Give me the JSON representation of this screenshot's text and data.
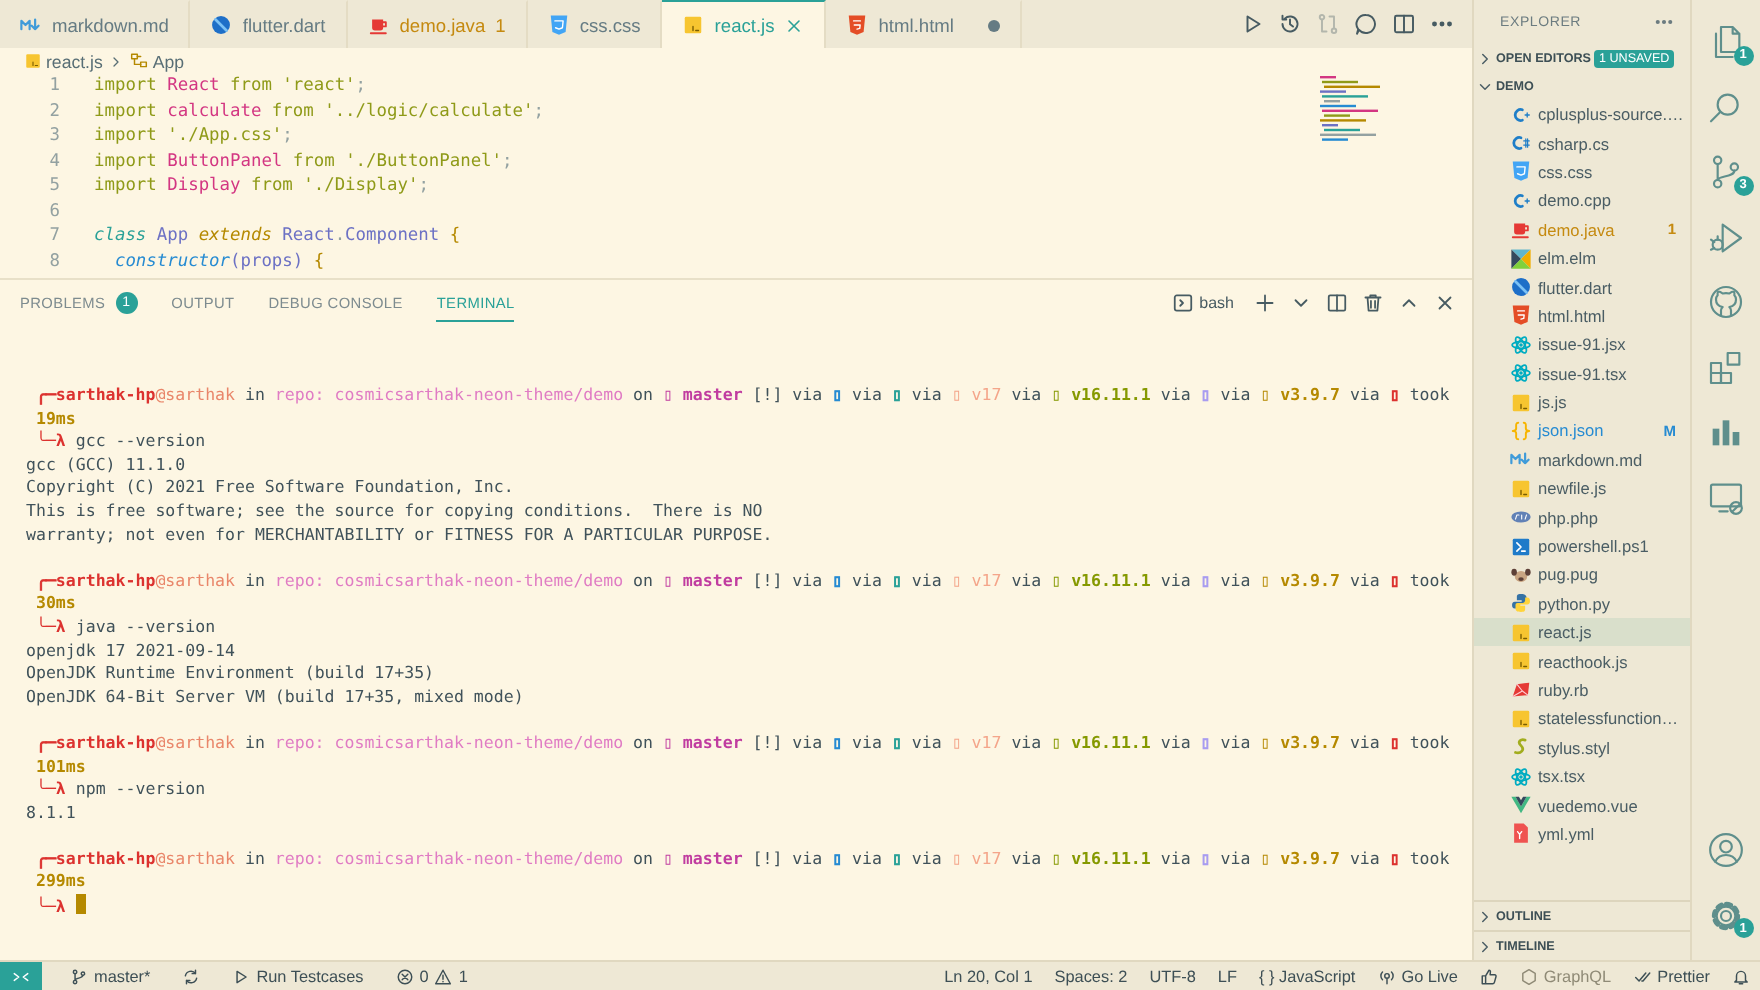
{
  "tabs": [
    {
      "label": "markdown.md",
      "kind": "md",
      "selected": false,
      "dirty": false
    },
    {
      "label": "flutter.dart",
      "kind": "dart",
      "selected": false,
      "dirty": false
    },
    {
      "label": "demo.java",
      "kind": "java",
      "selected": false,
      "dirty": false,
      "problems": "1"
    },
    {
      "label": "css.css",
      "kind": "css",
      "selected": false,
      "dirty": false
    },
    {
      "label": "react.js",
      "kind": "js",
      "selected": true,
      "dirty": false
    },
    {
      "label": "html.html",
      "kind": "html",
      "selected": false,
      "dirty": true
    }
  ],
  "editor_actions": [
    {
      "kind": "run",
      "disabled": false
    },
    {
      "kind": "history",
      "disabled": false
    },
    {
      "kind": "compare",
      "disabled": true
    },
    {
      "kind": "comment",
      "disabled": false
    },
    {
      "kind": "split",
      "disabled": false
    },
    {
      "kind": "more",
      "disabled": false
    }
  ],
  "breadcrumb": [
    {
      "label": "react.js",
      "kind": "js"
    },
    {
      "label": "App",
      "kind": "class"
    }
  ],
  "code": [
    {
      "number": "1",
      "tokens": [
        {
          "text": "import ",
          "kind": "keyword"
        },
        {
          "text": "React",
          "kind": "name"
        },
        {
          "text": " from ",
          "kind": "keyword"
        },
        {
          "text": "'react'",
          "kind": "string"
        },
        {
          "text": ";",
          "kind": "punct"
        }
      ]
    },
    {
      "number": "2",
      "tokens": [
        {
          "text": "import ",
          "kind": "keyword"
        },
        {
          "text": "calculate",
          "kind": "name"
        },
        {
          "text": " from ",
          "kind": "keyword"
        },
        {
          "text": "'../logic/calculate'",
          "kind": "string"
        },
        {
          "text": ";",
          "kind": "punct"
        }
      ]
    },
    {
      "number": "3",
      "tokens": [
        {
          "text": "import ",
          "kind": "keyword"
        },
        {
          "text": "'./App.css'",
          "kind": "string"
        },
        {
          "text": ";",
          "kind": "punct"
        }
      ]
    },
    {
      "number": "4",
      "tokens": [
        {
          "text": "import ",
          "kind": "keyword"
        },
        {
          "text": "ButtonPanel",
          "kind": "name"
        },
        {
          "text": " from ",
          "kind": "keyword"
        },
        {
          "text": "'./ButtonPanel'",
          "kind": "string"
        },
        {
          "text": ";",
          "kind": "punct"
        }
      ]
    },
    {
      "number": "5",
      "tokens": [
        {
          "text": "import ",
          "kind": "keyword"
        },
        {
          "text": "Display",
          "kind": "name"
        },
        {
          "text": " from ",
          "kind": "keyword"
        },
        {
          "text": "'./Display'",
          "kind": "string"
        },
        {
          "text": ";",
          "kind": "punct"
        }
      ]
    },
    {
      "number": "6"
    },
    {
      "number": "7",
      "tokens": [
        {
          "text": "class ",
          "kind": "storage"
        },
        {
          "text": "App ",
          "kind": "type"
        },
        {
          "text": "extends ",
          "kind": "modifier"
        },
        {
          "text": "React",
          "kind": "type"
        },
        {
          "text": ".",
          "kind": "punct"
        },
        {
          "text": "Component ",
          "kind": "type"
        },
        {
          "text": "{",
          "kind": "brace"
        }
      ]
    },
    {
      "number": "8",
      "tokens": [
        {
          "text": "  constructor",
          "kind": "method"
        },
        {
          "text": "(props) ",
          "kind": "type"
        },
        {
          "text": "{",
          "kind": "brace"
        }
      ]
    }
  ],
  "panel": {
    "tabs": [
      {
        "label": "PROBLEMS",
        "badge": "1",
        "selected": false
      },
      {
        "label": "OUTPUT",
        "selected": false
      },
      {
        "label": "DEBUG CONSOLE",
        "selected": false
      },
      {
        "label": "TERMINAL",
        "selected": true
      }
    ],
    "shell": "bash",
    "actions": [
      {
        "kind": "new"
      },
      {
        "kind": "dropdown"
      },
      {
        "kind": "split"
      },
      {
        "kind": "trash"
      },
      {
        "kind": "maximize"
      },
      {
        "kind": "close"
      }
    ]
  },
  "terminal": [
    {
      "prompt": [
        {
          "text": "╭─",
          "color": "#dc322f"
        },
        {
          "text": "sarthak-hp",
          "color": "#dc322f",
          "bold": true
        },
        {
          "text": "@sarthak",
          "color": "#e9866a"
        },
        {
          "text": " in "
        },
        {
          "text": "repo: cosmicsarthak-neon-theme/demo",
          "color": "#e07cc4"
        },
        {
          "text": " on "
        },
        {
          "text": "▯ master",
          "color": "#c03ca0",
          "bold": true
        },
        {
          "text": " [!] via "
        },
        {
          "text": "▯",
          "color": "#268bd2"
        },
        {
          "text": " via "
        },
        {
          "text": "▯",
          "color": "#2aa198"
        },
        {
          "text": " via "
        },
        {
          "text": "▯ v17",
          "color": "#f4a58a"
        },
        {
          "text": " via "
        },
        {
          "text": "▯ v16.11.1",
          "color": "#859900",
          "bold": true
        },
        {
          "text": " via "
        },
        {
          "text": "▯",
          "color": "#a89cf0"
        },
        {
          "text": " via "
        },
        {
          "text": "▯ v3.9.7",
          "color": "#b58900",
          "bold": true
        },
        {
          "text": " via "
        },
        {
          "text": "▯",
          "color": "#dc322f"
        },
        {
          "text": " took"
        }
      ],
      "took": "19ms",
      "arrow": "╰─λ",
      "command": "gcc --version",
      "cursor": false,
      "output": [
        "gcc (GCC) 11.1.0",
        "Copyright (C) 2021 Free Software Foundation, Inc.",
        "This is free software; see the source for copying conditions.  There is NO",
        "warranty; not even for MERCHANTABILITY or FITNESS FOR A PARTICULAR PURPOSE."
      ]
    },
    {
      "prompt": [
        {
          "text": "╭─",
          "color": "#dc322f"
        },
        {
          "text": "sarthak-hp",
          "color": "#dc322f",
          "bold": true
        },
        {
          "text": "@sarthak",
          "color": "#e9866a"
        },
        {
          "text": " in "
        },
        {
          "text": "repo: cosmicsarthak-neon-theme/demo",
          "color": "#e07cc4"
        },
        {
          "text": " on "
        },
        {
          "text": "▯ master",
          "color": "#c03ca0",
          "bold": true
        },
        {
          "text": " [!] via "
        },
        {
          "text": "▯",
          "color": "#268bd2"
        },
        {
          "text": " via "
        },
        {
          "text": "▯",
          "color": "#2aa198"
        },
        {
          "text": " via "
        },
        {
          "text": "▯ v17",
          "color": "#f4a58a"
        },
        {
          "text": " via "
        },
        {
          "text": "▯ v16.11.1",
          "color": "#859900",
          "bold": true
        },
        {
          "text": " via "
        },
        {
          "text": "▯",
          "color": "#a89cf0"
        },
        {
          "text": " via "
        },
        {
          "text": "▯ v3.9.7",
          "color": "#b58900",
          "bold": true
        },
        {
          "text": " via "
        },
        {
          "text": "▯",
          "color": "#dc322f"
        },
        {
          "text": " took"
        }
      ],
      "took": "30ms",
      "arrow": "╰─λ",
      "command": "java --version",
      "cursor": false,
      "output": [
        "openjdk 17 2021-09-14",
        "OpenJDK Runtime Environment (build 17+35)",
        "OpenJDK 64-Bit Server VM (build 17+35, mixed mode)"
      ]
    },
    {
      "prompt": [
        {
          "text": "╭─",
          "color": "#dc322f"
        },
        {
          "text": "sarthak-hp",
          "color": "#dc322f",
          "bold": true
        },
        {
          "text": "@sarthak",
          "color": "#e9866a"
        },
        {
          "text": " in "
        },
        {
          "text": "repo: cosmicsarthak-neon-theme/demo",
          "color": "#e07cc4"
        },
        {
          "text": " on "
        },
        {
          "text": "▯ master",
          "color": "#c03ca0",
          "bold": true
        },
        {
          "text": " [!] via "
        },
        {
          "text": "▯",
          "color": "#268bd2"
        },
        {
          "text": " via "
        },
        {
          "text": "▯",
          "color": "#2aa198"
        },
        {
          "text": " via "
        },
        {
          "text": "▯ v17",
          "color": "#f4a58a"
        },
        {
          "text": " via "
        },
        {
          "text": "▯ v16.11.1",
          "color": "#859900",
          "bold": true
        },
        {
          "text": " via "
        },
        {
          "text": "▯",
          "color": "#a89cf0"
        },
        {
          "text": " via "
        },
        {
          "text": "▯ v3.9.7",
          "color": "#b58900",
          "bold": true
        },
        {
          "text": " via "
        },
        {
          "text": "▯",
          "color": "#dc322f"
        },
        {
          "text": " took"
        }
      ],
      "took": "101ms",
      "arrow": "╰─λ",
      "command": "npm --version",
      "cursor": false,
      "output": [
        "8.1.1"
      ]
    },
    {
      "prompt": [
        {
          "text": "╭─",
          "color": "#dc322f"
        },
        {
          "text": "sarthak-hp",
          "color": "#dc322f",
          "bold": true
        },
        {
          "text": "@sarthak",
          "color": "#e9866a"
        },
        {
          "text": " in "
        },
        {
          "text": "repo: cosmicsarthak-neon-theme/demo",
          "color": "#e07cc4"
        },
        {
          "text": " on "
        },
        {
          "text": "▯ master",
          "color": "#c03ca0",
          "bold": true
        },
        {
          "text": " [!] via "
        },
        {
          "text": "▯",
          "color": "#268bd2"
        },
        {
          "text": " via "
        },
        {
          "text": "▯",
          "color": "#2aa198"
        },
        {
          "text": " via "
        },
        {
          "text": "▯ v17",
          "color": "#f4a58a"
        },
        {
          "text": " via "
        },
        {
          "text": "▯ v16.11.1",
          "color": "#859900",
          "bold": true
        },
        {
          "text": " via "
        },
        {
          "text": "▯",
          "color": "#a89cf0"
        },
        {
          "text": " via "
        },
        {
          "text": "▯ v3.9.7",
          "color": "#b58900",
          "bold": true
        },
        {
          "text": " via "
        },
        {
          "text": "▯",
          "color": "#dc322f"
        },
        {
          "text": " took"
        }
      ],
      "took": "299ms",
      "arrow": "╰─λ",
      "cursor": true
    }
  ],
  "explorer": {
    "title": "EXPLORER",
    "panes": [
      {
        "label": "OPEN EDITORS",
        "expanded": false,
        "badge": "1 UNSAVED"
      },
      {
        "label": "DEMO",
        "expanded": true,
        "files": [
          {
            "name": "cplusplus-source.…",
            "kind": "cpp",
            "selected": false,
            "problem": false,
            "modified": false
          },
          {
            "name": "csharp.cs",
            "kind": "cs",
            "selected": false,
            "problem": false,
            "modified": false
          },
          {
            "name": "css.css",
            "kind": "css",
            "selected": false,
            "problem": false,
            "modified": false
          },
          {
            "name": "demo.cpp",
            "kind": "cpp",
            "selected": false,
            "problem": false,
            "modified": false
          },
          {
            "name": "demo.java",
            "kind": "java",
            "selected": false,
            "problem": true,
            "modified": false,
            "count": "1"
          },
          {
            "name": "elm.elm",
            "kind": "elm",
            "selected": false,
            "problem": false,
            "modified": false
          },
          {
            "name": "flutter.dart",
            "kind": "dart",
            "selected": false,
            "problem": false,
            "modified": false
          },
          {
            "name": "html.html",
            "kind": "html",
            "selected": false,
            "problem": false,
            "modified": false
          },
          {
            "name": "issue-91.jsx",
            "kind": "react",
            "selected": false,
            "problem": false,
            "modified": false
          },
          {
            "name": "issue-91.tsx",
            "kind": "react",
            "selected": false,
            "problem": false,
            "modified": false
          },
          {
            "name": "js.js",
            "kind": "js",
            "selected": false,
            "problem": false,
            "modified": false
          },
          {
            "name": "json.json",
            "kind": "json",
            "selected": false,
            "problem": false,
            "modified": true,
            "count": "M"
          },
          {
            "name": "markdown.md",
            "kind": "md",
            "selected": false,
            "problem": false,
            "modified": false
          },
          {
            "name": "newfile.js",
            "kind": "js",
            "selected": false,
            "problem": false,
            "modified": false
          },
          {
            "name": "php.php",
            "kind": "php",
            "selected": false,
            "problem": false,
            "modified": false
          },
          {
            "name": "powershell.ps1",
            "kind": "ps1",
            "selected": false,
            "problem": false,
            "modified": false
          },
          {
            "name": "pug.pug",
            "kind": "pug",
            "selected": false,
            "problem": false,
            "modified": false
          },
          {
            "name": "python.py",
            "kind": "py",
            "selected": false,
            "problem": false,
            "modified": false
          },
          {
            "name": "react.js",
            "kind": "js",
            "selected": true,
            "problem": false,
            "modified": false
          },
          {
            "name": "reacthook.js",
            "kind": "js",
            "selected": false,
            "problem": false,
            "modified": false
          },
          {
            "name": "ruby.rb",
            "kind": "rb",
            "selected": false,
            "problem": false,
            "modified": false
          },
          {
            "name": "statelessfunction…",
            "kind": "js",
            "selected": false,
            "problem": false,
            "modified": false
          },
          {
            "name": "stylus.styl",
            "kind": "styl",
            "selected": false,
            "problem": false,
            "modified": false
          },
          {
            "name": "tsx.tsx",
            "kind": "react",
            "selected": false,
            "problem": false,
            "modified": false
          },
          {
            "name": "vuedemo.vue",
            "kind": "vue",
            "selected": false,
            "problem": false,
            "modified": false
          },
          {
            "name": "yml.yml",
            "kind": "yml",
            "selected": false,
            "problem": false,
            "modified": false
          }
        ]
      },
      {
        "label": "OUTLINE",
        "expanded": false
      },
      {
        "label": "TIMELINE",
        "expanded": false
      }
    ]
  },
  "activity": {
    "top": [
      {
        "kind": "files",
        "badge": "1"
      },
      {
        "kind": "search"
      },
      {
        "kind": "scm",
        "badge": "3"
      },
      {
        "kind": "debug"
      },
      {
        "kind": "github"
      },
      {
        "kind": "extensions"
      },
      {
        "kind": "chart"
      },
      {
        "kind": "remote"
      }
    ],
    "bottom": [
      {
        "kind": "account"
      },
      {
        "kind": "settings",
        "badge": "1"
      }
    ]
  },
  "status_bar": {
    "left": [
      {
        "kind": "remote"
      },
      {
        "kind": "branch",
        "label": "master*"
      },
      {
        "kind": "sync"
      },
      {
        "kind": "run",
        "label": "Run Testcases"
      },
      {
        "kind": "problems",
        "errors": "0",
        "warnings": "1"
      }
    ],
    "right": [
      {
        "kind": "text",
        "label": "Ln 20, Col 1"
      },
      {
        "kind": "text",
        "label": "Spaces: 2"
      },
      {
        "kind": "text",
        "label": "UTF-8"
      },
      {
        "kind": "text",
        "label": "LF"
      },
      {
        "kind": "language",
        "label": "{ } JavaScript"
      },
      {
        "kind": "golive",
        "label": "Go Live"
      },
      {
        "kind": "feedback"
      },
      {
        "kind": "graphql",
        "label": "GraphQL",
        "disabled": true
      },
      {
        "kind": "prettier",
        "label": "Prettier"
      },
      {
        "kind": "bell"
      }
    ]
  }
}
